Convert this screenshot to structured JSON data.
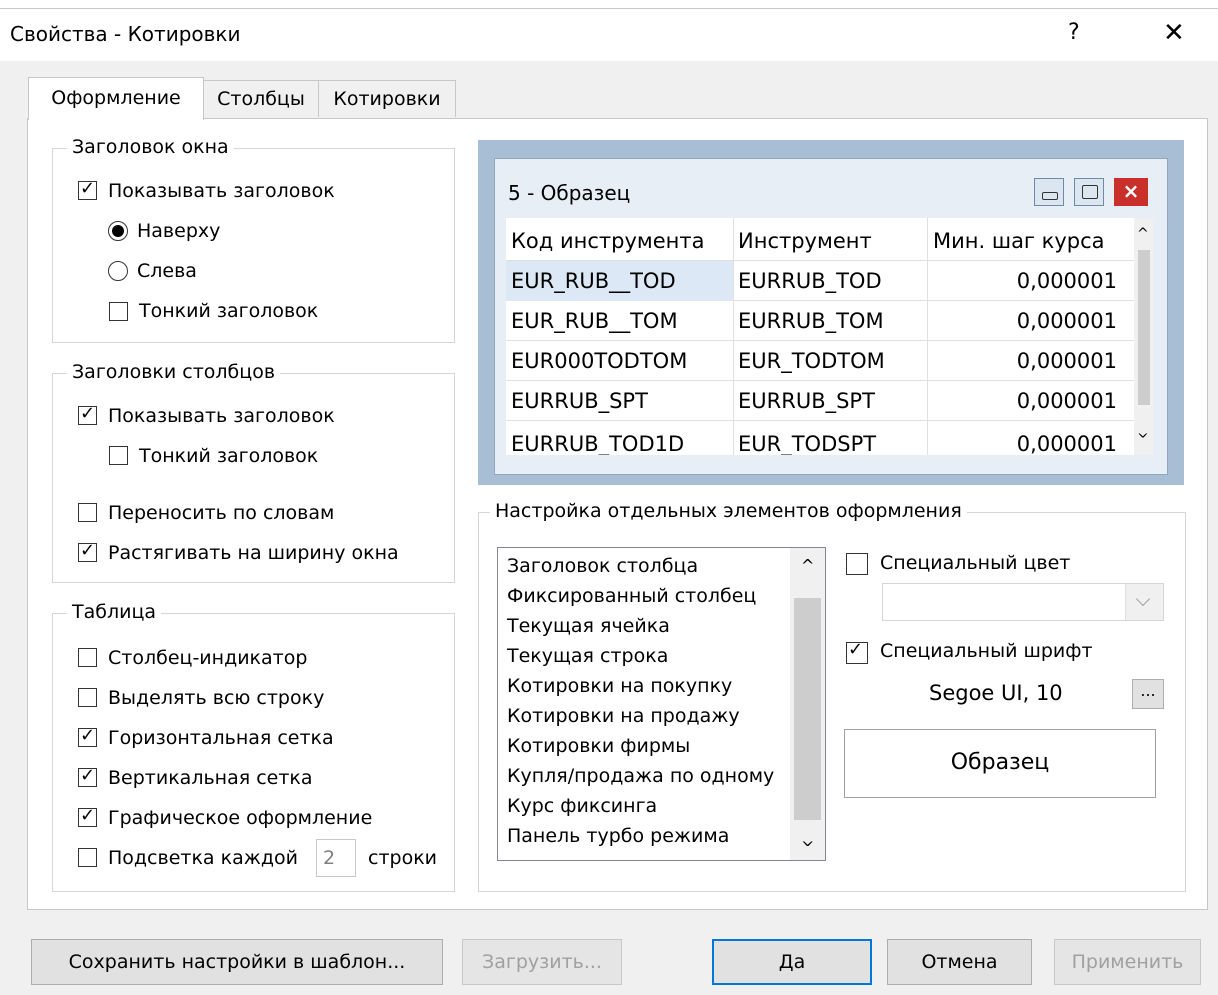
{
  "window": {
    "title": "Свойства - Котировки",
    "help": "?",
    "close": "✕"
  },
  "tabs": [
    {
      "label": "Оформление"
    },
    {
      "label": "Столбцы"
    },
    {
      "label": "Котировки"
    }
  ],
  "group_window_title": {
    "label": "Заголовок окна",
    "show_title": {
      "label": "Показывать заголовок",
      "checked": true
    },
    "top": {
      "label": "Наверху",
      "selected": true
    },
    "left": {
      "label": "Слева",
      "selected": false
    },
    "thin": {
      "label": "Тонкий заголовок",
      "checked": false
    }
  },
  "group_column_headers": {
    "label": "Заголовки столбцов",
    "show_header": {
      "label": "Показывать заголовок",
      "checked": true
    },
    "thin": {
      "label": "Тонкий заголовок",
      "checked": false
    },
    "wrap": {
      "label": "Переносить по словам",
      "checked": false
    },
    "stretch": {
      "label": "Растягивать на ширину окна",
      "checked": true
    }
  },
  "group_table": {
    "label": "Таблица",
    "indicator": {
      "label": "Столбец-индикатор",
      "checked": false
    },
    "select_row": {
      "label": "Выделять всю строку",
      "checked": false
    },
    "hgrid": {
      "label": "Горизонтальная сетка",
      "checked": true
    },
    "vgrid": {
      "label": "Вертикальная сетка",
      "checked": true
    },
    "graphic": {
      "label": "Графическое оформление",
      "checked": true
    },
    "highlight": {
      "label": "Подсветка каждой",
      "checked": false,
      "value": "2",
      "suffix": "строки"
    }
  },
  "sample": {
    "title": "5 - Образец",
    "columns": [
      "Код инструмента",
      "Инструмент",
      "Мин. шаг курса"
    ],
    "rows": [
      [
        "EUR_RUB__TOD",
        "EURRUB_TOD",
        "0,000001"
      ],
      [
        "EUR_RUB__TOM",
        "EURRUB_TOM",
        "0,000001"
      ],
      [
        "EUR000TODTOM",
        "EUR_TODTOM",
        "0,000001"
      ],
      [
        "EURRUB_SPT",
        "EURRUB_SPT",
        "0,000001"
      ],
      [
        "EURRUB_TOD1D",
        "EUR_TODSPT",
        "0,000001"
      ]
    ],
    "close_glyph": "×"
  },
  "elements_group": {
    "label": "Настройка отдельных элементов оформления",
    "items": [
      "Заголовок столбца",
      "Фиксированный столбец",
      "Текущая ячейка",
      "Текущая строка",
      "Котировки на покупку",
      "Котировки на продажу",
      "Котировки фирмы",
      "Купля/продажа по одному",
      "Курс фиксинга",
      "Панель турбо режима"
    ],
    "special_color": {
      "label": "Специальный цвет",
      "checked": false
    },
    "special_font": {
      "label": "Специальный шрифт",
      "checked": true
    },
    "font_value": "Segoe UI, 10",
    "font_button": "...",
    "preview": "Образец"
  },
  "buttons": {
    "save_template": "Сохранить настройки в шаблон...",
    "load": "Загрузить...",
    "ok": "Да",
    "cancel": "Отмена",
    "apply": "Применить"
  }
}
